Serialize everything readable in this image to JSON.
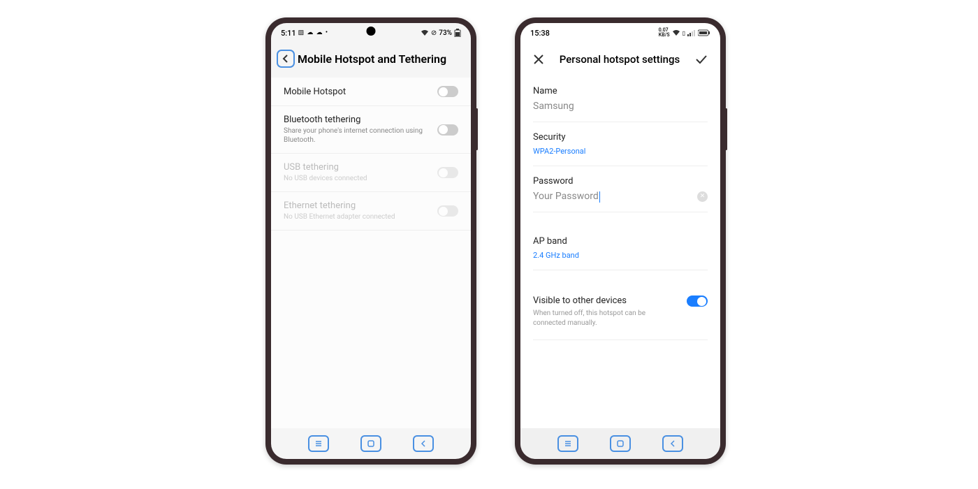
{
  "phoneA": {
    "statusbar": {
      "time": "5:11",
      "battery_text": "73%"
    },
    "page_title": "Mobile Hotspot and Tethering",
    "rows": [
      {
        "title": "Mobile Hotspot",
        "sub": "",
        "disabled": false
      },
      {
        "title": "Bluetooth tethering",
        "sub": "Share your phone's internet connection using Bluetooth.",
        "disabled": false
      },
      {
        "title": "USB tethering",
        "sub": "No USB devices connected",
        "disabled": true
      },
      {
        "title": "Ethernet tethering",
        "sub": "No USB Ethernet adapter connected",
        "disabled": true
      }
    ]
  },
  "phoneB": {
    "statusbar": {
      "time": "15:38"
    },
    "page_title": "Personal hotspot settings",
    "name": {
      "label": "Name",
      "value": "Samsung"
    },
    "security": {
      "label": "Security",
      "value": "WPA2-Personal"
    },
    "password": {
      "label": "Password",
      "value": "Your Password"
    },
    "apband": {
      "label": "AP band",
      "value": "2.4 GHz band"
    },
    "visible": {
      "label": "Visible to other devices",
      "sub": "When turned off, this hotspot can be connected manually."
    }
  }
}
